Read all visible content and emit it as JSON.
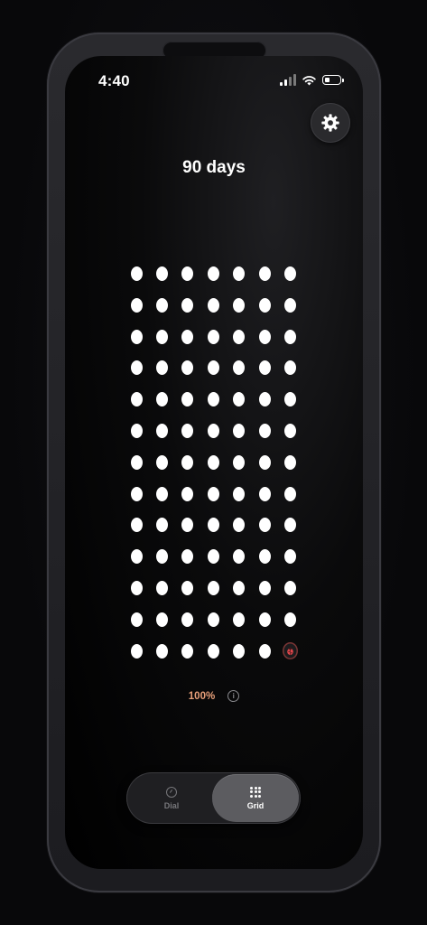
{
  "status_bar": {
    "time": "4:40",
    "icons": [
      "cellular-signal-icon",
      "wifi-icon",
      "battery-icon"
    ],
    "battery_level": 0.35
  },
  "header": {
    "title": "90 days",
    "settings_icon": "gear-icon"
  },
  "grid": {
    "columns": 7,
    "total_days": 91,
    "completed_days": 90,
    "current_day_icon": "ladybug-icon",
    "dot_color": "#ffffff"
  },
  "progress": {
    "percent_label": "100%",
    "info_icon": "info-icon",
    "color": "#e8a07a"
  },
  "view_toggle": {
    "options": [
      {
        "label": "Dial",
        "icon": "dial-icon",
        "selected": false
      },
      {
        "label": "Grid",
        "icon": "grid-icon",
        "selected": true
      }
    ]
  }
}
